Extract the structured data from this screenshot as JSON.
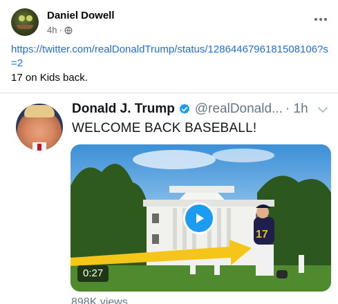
{
  "post": {
    "author": "Daniel Dowell",
    "time": "4h",
    "separator": "·",
    "link": "https://twitter.com/realDonaldTrump/status/1286446796181508106?s=2",
    "text": "17 on Kids back."
  },
  "tweet": {
    "name": "Donald J. Trump",
    "handle": "@realDonald...",
    "time": "· 1h",
    "text": "WELCOME BACK BASEBALL!",
    "video_duration": "0:27",
    "views": "898K views"
  },
  "colors": {
    "link": "#216fdb",
    "twitter_blue": "#1d9bf0",
    "annotation_arrow": "#f5c518"
  },
  "icons": {
    "privacy": "globe-icon",
    "menu": "more-horizontal-icon",
    "verified": "verified-badge-icon",
    "tweet_menu": "chevron-down-icon",
    "video": "play-icon"
  }
}
